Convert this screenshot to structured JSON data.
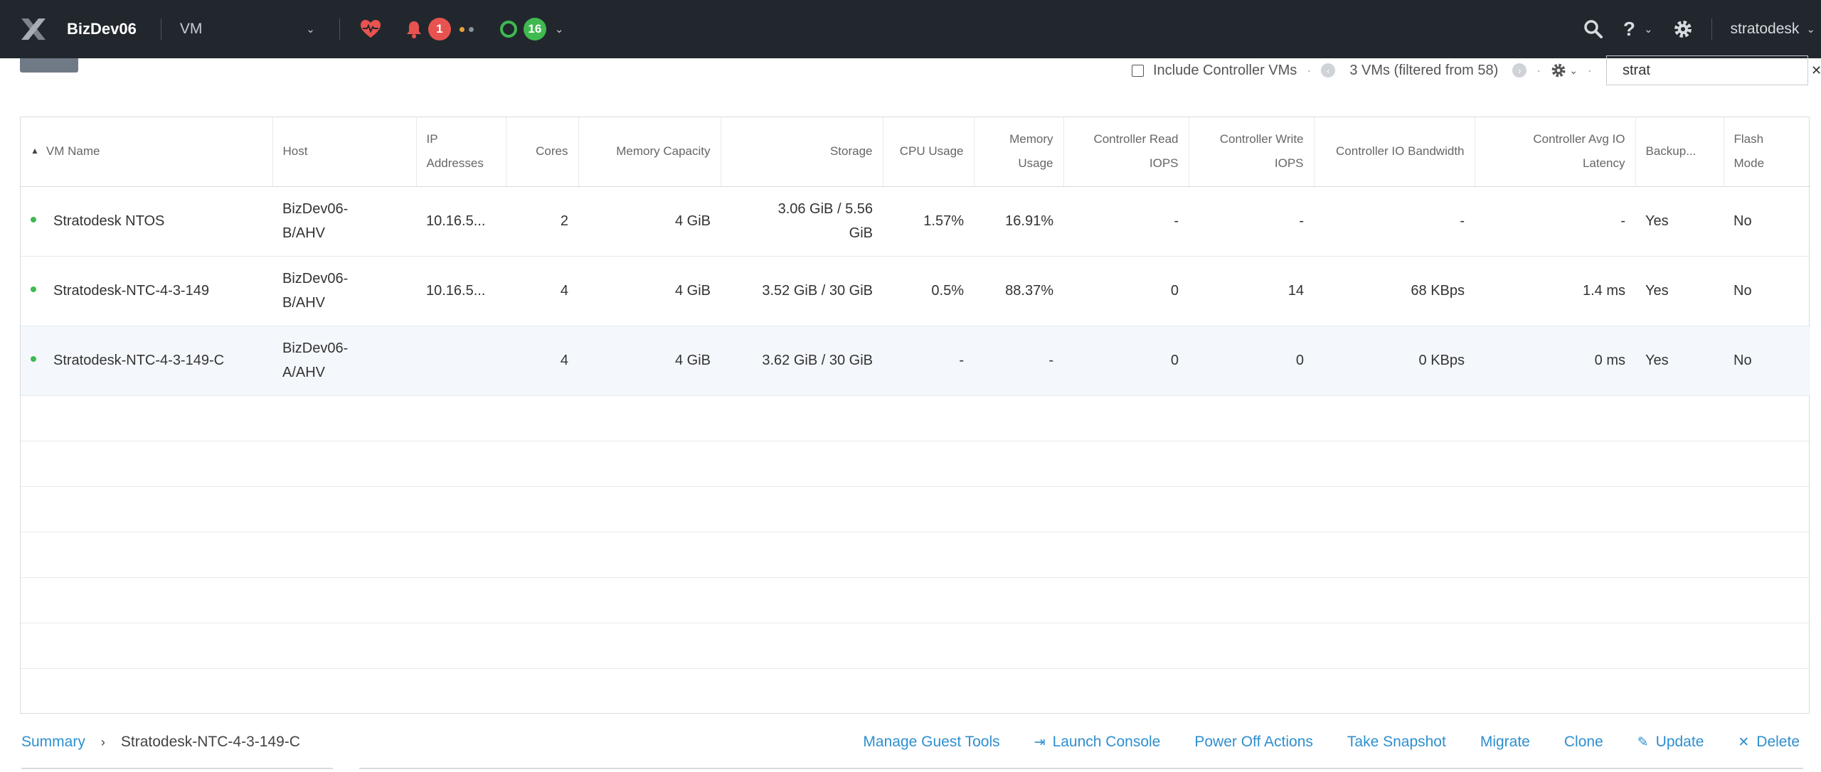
{
  "topbar": {
    "cluster_name": "BizDev06",
    "menu": "VM",
    "alerts_count": "1",
    "tasks_count": "16",
    "username": "stratodesk"
  },
  "toolbar": {
    "include_controller_label": "Include Controller VMs",
    "count_label": "3 VMs (filtered from 58)",
    "search_value": "strat"
  },
  "table": {
    "headers": {
      "vm_name": "VM Name",
      "host": "Host",
      "ip_1": "IP",
      "ip_2": "Addresses",
      "cores": "Cores",
      "memory_capacity": "Memory Capacity",
      "storage": "Storage",
      "cpu_usage": "CPU Usage",
      "mem_usage_1": "Memory",
      "mem_usage_2": "Usage",
      "ctrl_read_1": "Controller Read",
      "ctrl_read_2": "IOPS",
      "ctrl_write_1": "Controller Write",
      "ctrl_write_2": "IOPS",
      "ctrl_bw": "Controller IO Bandwidth",
      "ctrl_lat_1": "Controller Avg IO",
      "ctrl_lat_2": "Latency",
      "backup": "Backup...",
      "flash_1": "Flash",
      "flash_2": "Mode"
    },
    "rows": [
      {
        "name": "Stratodesk NTOS",
        "host_1": "BizDev06-",
        "host_2": "B/AHV",
        "ip": "10.16.5...",
        "cores": "2",
        "memory": "4 GiB",
        "storage_1": "3.06 GiB / 5.56",
        "storage_2": "GiB",
        "cpu": "1.57%",
        "mem_usage": "16.91%",
        "read_iops": "-",
        "write_iops": "-",
        "bandwidth": "-",
        "latency": "-",
        "backup": "Yes",
        "flash": "No"
      },
      {
        "name": "Stratodesk-NTC-4-3-149",
        "host_1": "BizDev06-",
        "host_2": "B/AHV",
        "ip": "10.16.5...",
        "cores": "4",
        "memory": "4 GiB",
        "storage_1": "3.52 GiB / 30 GiB",
        "storage_2": "",
        "cpu": "0.5%",
        "mem_usage": "88.37%",
        "read_iops": "0",
        "write_iops": "14",
        "bandwidth": "68 KBps",
        "latency": "1.4 ms",
        "backup": "Yes",
        "flash": "No"
      },
      {
        "name": "Stratodesk-NTC-4-3-149-C",
        "host_1": "BizDev06-",
        "host_2": "A/AHV",
        "ip": "",
        "cores": "4",
        "memory": "4 GiB",
        "storage_1": "3.62 GiB / 30 GiB",
        "storage_2": "",
        "cpu": "-",
        "mem_usage": "-",
        "read_iops": "0",
        "write_iops": "0",
        "bandwidth": "0 KBps",
        "latency": "0 ms",
        "backup": "Yes",
        "flash": "No"
      }
    ]
  },
  "bottombar": {
    "summary": "Summary",
    "selected_vm": "Stratodesk-NTC-4-3-149-C",
    "actions": {
      "guest_tools": "Manage Guest Tools",
      "launch_console": "Launch Console",
      "power_off": "Power Off Actions",
      "snapshot": "Take Snapshot",
      "migrate": "Migrate",
      "clone": "Clone",
      "update": "Update",
      "delete": "Delete"
    }
  },
  "colors": {
    "topbar_bg": "#22272e",
    "link_blue": "#2e8fd0",
    "alert_red": "#e8534f",
    "ok_green": "#3fb950"
  }
}
